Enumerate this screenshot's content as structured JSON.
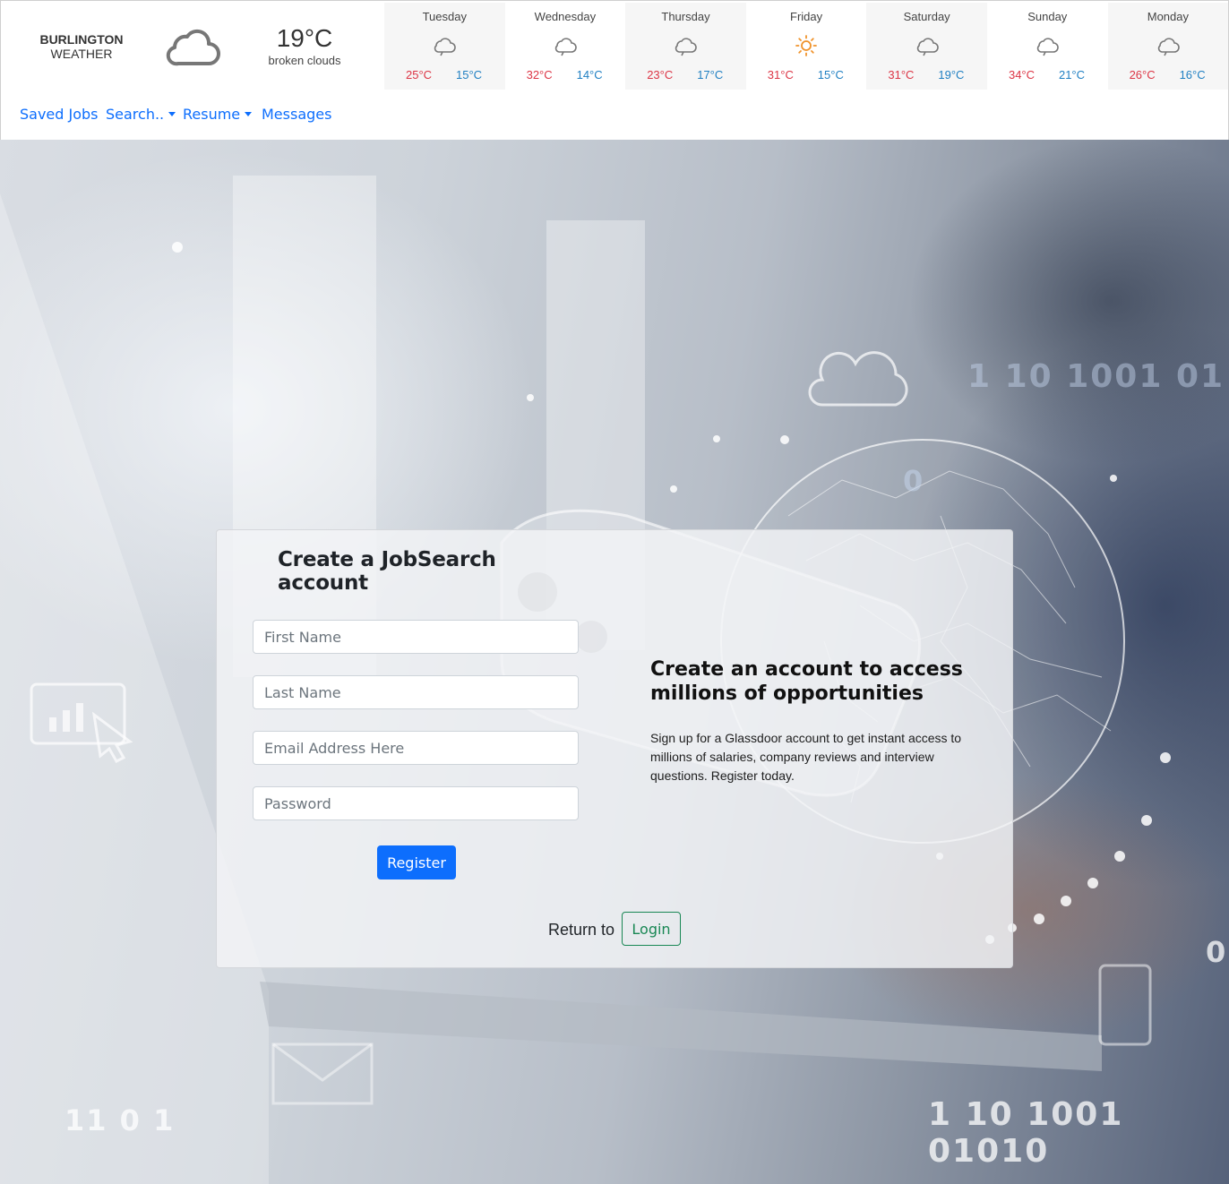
{
  "weather": {
    "city_line1": "BURLINGTON",
    "city_line2": "WEATHER",
    "current_icon": "cloud-icon",
    "current_temp": "19°C",
    "current_desc": "broken clouds",
    "forecast": [
      {
        "day": "Tuesday",
        "icon": "cloud-icon",
        "high": "25°C",
        "low": "15°C"
      },
      {
        "day": "Wednesday",
        "icon": "cloud-icon",
        "high": "32°C",
        "low": "14°C"
      },
      {
        "day": "Thursday",
        "icon": "cloud-icon",
        "high": "23°C",
        "low": "17°C"
      },
      {
        "day": "Friday",
        "icon": "sun-icon",
        "high": "31°C",
        "low": "15°C"
      },
      {
        "day": "Saturday",
        "icon": "cloud-icon",
        "high": "31°C",
        "low": "19°C"
      },
      {
        "day": "Sunday",
        "icon": "cloud-icon",
        "high": "34°C",
        "low": "21°C"
      },
      {
        "day": "Monday",
        "icon": "cloud-icon",
        "high": "26°C",
        "low": "16°C"
      }
    ],
    "colors": {
      "high": "#dc3545",
      "low": "#1f7fc2",
      "sun": "#f0932b"
    }
  },
  "nav": {
    "saved_jobs": "Saved Jobs",
    "search": "Search..",
    "resume": "Resume",
    "messages": "Messages"
  },
  "background": {
    "digits": [
      "1 10 1001 01",
      "0",
      "11 0 1",
      "1 10 1001 01010",
      "0"
    ]
  },
  "form": {
    "title": "Create a JobSearch account",
    "first_name_placeholder": "First Name",
    "last_name_placeholder": "Last Name",
    "email_placeholder": "Email Address Here",
    "password_placeholder": "Password",
    "register_label": "Register",
    "return_label": "Return to",
    "login_label": "Login"
  },
  "promo": {
    "title": "Create an account to access millions of opportunities",
    "text": "Sign up for a Glassdoor account to get instant access to millions of salaries, company reviews and interview questions. Register today."
  },
  "theme": {
    "primary": "#0d6efd",
    "success": "#198754"
  }
}
